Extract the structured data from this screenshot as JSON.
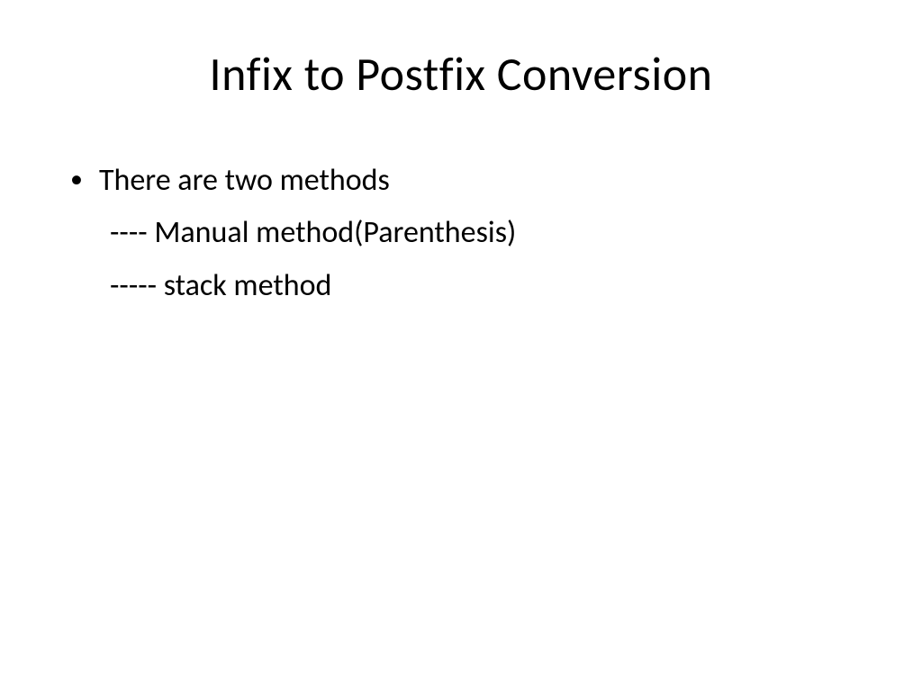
{
  "slide": {
    "title": "Infix to Postfix  Conversion",
    "bullet_text": "There  are  two  methods",
    "sub_items": [
      "----   Manual  method(Parenthesis)",
      "-----  stack  method"
    ]
  }
}
